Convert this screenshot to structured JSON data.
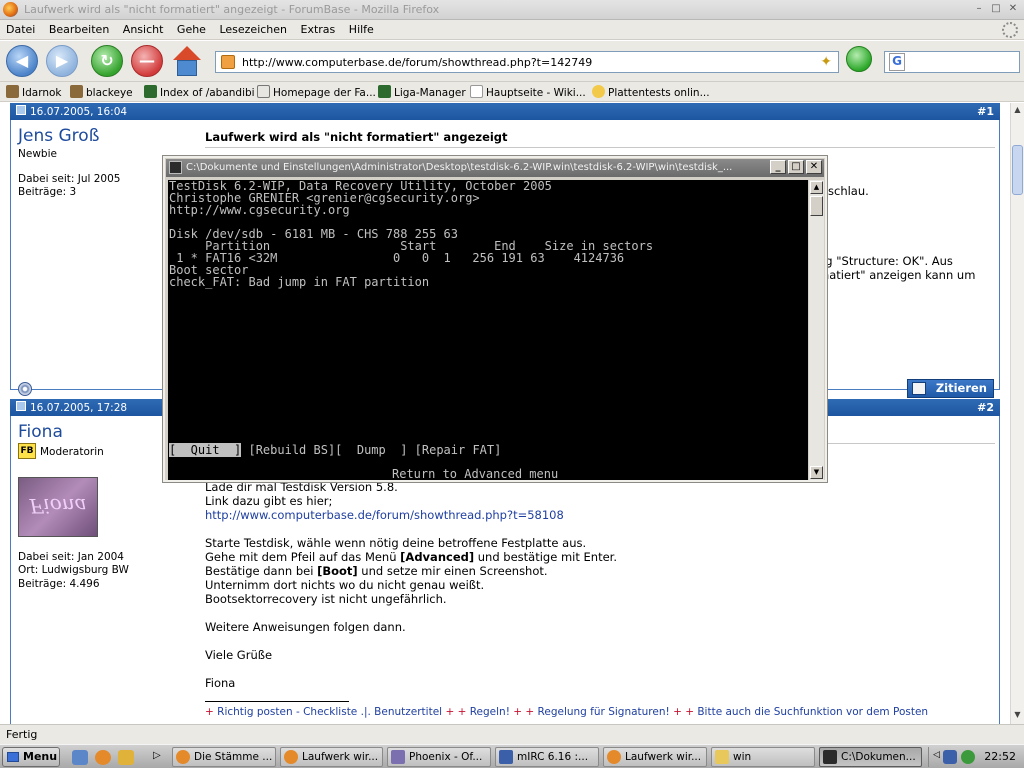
{
  "browser": {
    "title": "Laufwerk wird als \"nicht formatiert\" angezeigt - ForumBase - Mozilla Firefox",
    "menu": [
      "Datei",
      "Bearbeiten",
      "Ansicht",
      "Gehe",
      "Lesezeichen",
      "Extras",
      "Hilfe"
    ],
    "url": "http://www.computerbase.de/forum/showthread.php?t=142749",
    "search_engine_letter": "G",
    "bookmarks": [
      "Idarnok",
      "blackeye",
      "Index of /abandibi",
      "Homepage der Fa...",
      "Liga-Manager",
      "Hauptseite - Wiki...",
      "Plattentests onlin..."
    ],
    "status": "Fertig"
  },
  "posts": [
    {
      "date": "16.07.2005, 16:04",
      "number": "#1",
      "author": "Jens Groß",
      "rank": "Newbie",
      "joined": "Dabei seit: Jul 2005",
      "posts_count": "Beiträge: 3",
      "title": "Laufwerk wird als \"nicht formatiert\" angezeigt",
      "partial_1": "schlau.",
      "partial_2": "ng \"Structure: OK\". Aus",
      "partial_3": "matiert\" anzeigen kann um",
      "quote_label": "Zitieren"
    },
    {
      "date": "16.07.2005, 17:28",
      "number": "#2",
      "author": "Fiona",
      "rank": "Moderatorin",
      "badge": "FB",
      "avatar_text": "Fiona",
      "joined": "Dabei seit: Jan 2004",
      "location": "Ort: Ludwigsburg BW",
      "posts_count": "Beiträge: 4.496",
      "body_partial_top": "Lade dir mal Testdisk Version 5.8.",
      "link_intro": "Link dazu gibt es hier;",
      "link": "http://www.computerbase.de/forum/showthread.php?t=58108",
      "line_1": "Starte Testdisk, wähle wenn nötig deine betroffene Festplatte aus.",
      "line_2a": "Gehe mit dem Pfeil auf das Menü ",
      "line_2b": "[Advanced]",
      "line_2c": " und bestätige mit Enter.",
      "line_3a": "Bestätige dann bei ",
      "line_3b": "[Boot]",
      "line_3c": " und setze mir einen Screenshot.",
      "line_4": "Unternimm dort nichts wo du nicht genau weißt.",
      "line_5": "Bootsektorrecovery ist nicht ungefährlich.",
      "line_6": "Weitere Anweisungen folgen dann.",
      "line_7": "Viele Grüße",
      "line_8": "Fiona",
      "signature": {
        "s1": "Richtig posten - Checkliste",
        "s2": ".|. Benutzertitel",
        "s3": "Regeln!",
        "s4": "Regelung für Signaturen!",
        "s5": "Bitte auch die Suchfunktion vor dem Posten"
      }
    }
  ],
  "console": {
    "title": "C:\\Dokumente und Einstellungen\\Administrator\\Desktop\\testdisk-6.2-WIP.win\\testdisk-6.2-WIP\\win\\testdisk_...",
    "lines": [
      "TestDisk 6.2-WIP, Data Recovery Utility, October 2005",
      "Christophe GRENIER <grenier@cgsecurity.org>",
      "http://www.cgsecurity.org",
      "",
      "Disk /dev/sdb - 6181 MB - CHS 788 255 63",
      "     Partition                  Start        End    Size in sectors",
      " 1 * FAT16 <32M                0   0  1   256 191 63    4124736",
      "Boot sector",
      "check_FAT: Bad jump in FAT partition"
    ],
    "menu_selected": "[  Quit  ]",
    "menu_rest": " [Rebuild BS][  Dump  ] [Repair FAT]",
    "footer": "Return to Advanced menu"
  },
  "taskbar": {
    "start": "Menu",
    "tasks": [
      "Die Stämme ...",
      "Laufwerk wir...",
      "Phoenix - Of...",
      "mIRC 6.16 :...",
      "Laufwerk wir...",
      "win",
      "C:\\Dokumen..."
    ],
    "clock": "22:52"
  }
}
